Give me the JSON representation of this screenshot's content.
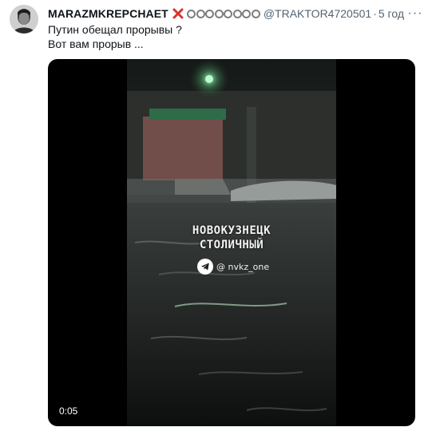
{
  "tweet": {
    "display_name": "MARAZMKREPCHAET",
    "name_emoji_icons": [
      "cross-mark-icon",
      "ring-icon"
    ],
    "handle": "@TRAKTOR4720501",
    "separator": "·",
    "time": "5 год",
    "more_icon": "more-options-icon",
    "text_lines": [
      "Путин обещал прорывы ?",
      "Вот вам прорыв ..."
    ]
  },
  "media": {
    "watermark_line1": "НОВОКУЗНЕЦК",
    "watermark_line2": "СТОЛИЧНЫЙ",
    "channel_icon": "telegram-icon",
    "channel_handle": "@ nvkz_one",
    "duration": "0:05"
  },
  "colors": {
    "text_primary": "#0f1419",
    "text_secondary": "#536471",
    "cross": "#d9322c",
    "video_bg": "#000000"
  }
}
